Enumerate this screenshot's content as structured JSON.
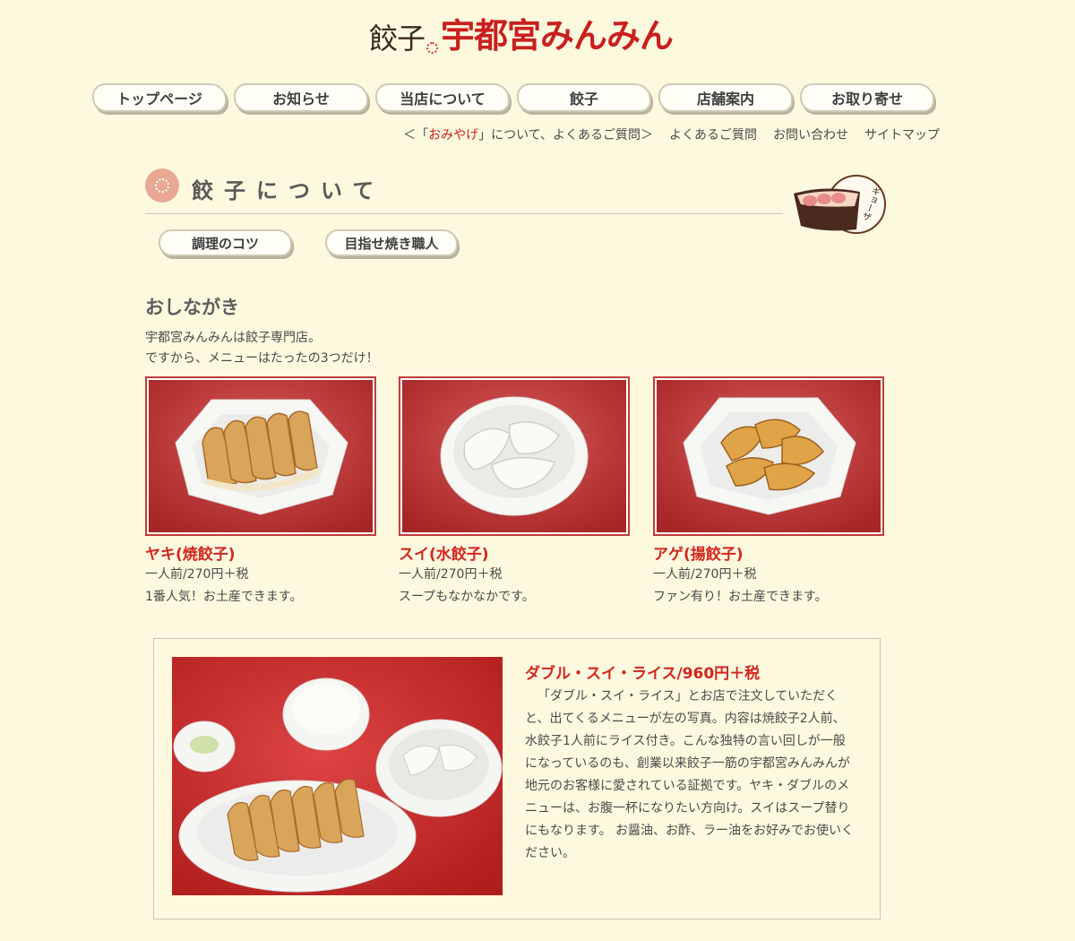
{
  "header": {
    "logo_sub": "餃子",
    "logo_main": "宇都宮みんみん"
  },
  "nav": {
    "items": [
      "トップページ",
      "お知らせ",
      "当店について",
      "餃子",
      "店舗案内",
      "お取り寄せ"
    ]
  },
  "subnav": {
    "omiyage_prefix": "＜「",
    "omiyage_highlight": "おみやげ",
    "omiyage_suffix": "」について、よくあるご質問＞",
    "faq": "よくあるご質問",
    "contact": "お問い合わせ",
    "sitemap": "サイトマップ"
  },
  "section": {
    "title": "餃子について",
    "mascot_label": "ギョーザ"
  },
  "subtabs": [
    "調理のコツ",
    "目指せ焼き職人"
  ],
  "menu": {
    "heading": "おしながき",
    "intro_line1": "宇都宮みんみんは餃子専門店。",
    "intro_line2": "ですから、メニューはたったの3つだけ！",
    "items": [
      {
        "name": "ヤキ(焼餃子)",
        "price": "一人前/270円＋税",
        "note": "1番人気！お土産できます。"
      },
      {
        "name": "スイ(水餃子)",
        "price": "一人前/270円＋税",
        "note": "スープもなかなかです。"
      },
      {
        "name": "アゲ(揚餃子)",
        "price": "一人前/270円＋税",
        "note": "ファン有り！お土産できます。"
      }
    ]
  },
  "combo": {
    "title": "ダブル・スイ・ライス/960円＋税",
    "text": "「ダブル・スイ・ライス」とお店で注文していただくと、出てくるメニューが左の写真。内容は焼餃子2人前、水餃子1人前にライス付き。こんな独特の言い回しが一般になっているのも、創業以来餃子一筋の宇都宮みんみんが地元のお客様に愛されている証拠です。ヤキ・ダブルのメニューは、お腹一杯になりたい方向け。スイはスープ替りにもなります。 お醤油、お酢、ラー油をお好みでお使いください。"
  },
  "colors": {
    "background": "#fdf9df",
    "accent_red": "#d0261e",
    "photo_red": "#c23a3a"
  }
}
